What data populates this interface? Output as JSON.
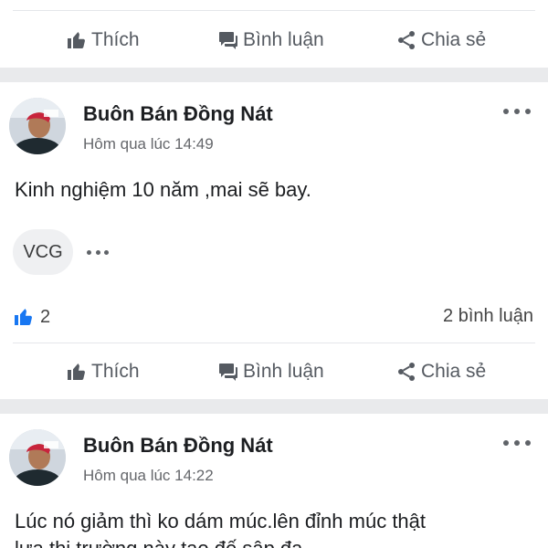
{
  "actions": {
    "like": "Thích",
    "comment": "Bình luận",
    "share": "Chia sẻ"
  },
  "posts": [
    {
      "author": "Buôn Bán Đồng Nát",
      "time": "Hôm qua lúc 14:49",
      "text": "Kinh nghiệm 10 năm ,mai sẽ bay.",
      "tag": "VCG",
      "likes": "2",
      "comments": "2 bình luận"
    },
    {
      "author": "Buôn Bán Đồng Nát",
      "time": "Hôm qua lúc 14:22",
      "text_line1": "Lúc nó giảm thì ko dám múc.lên đỉnh múc thật",
      "text_line2": "lựa thị trường này tạo đế sập đạ"
    }
  ],
  "colors": {
    "accent": "#1877f2",
    "icon_gray": "#555a61",
    "separator": "#e9eaec"
  },
  "icons": [
    "thumbs-up-icon",
    "comment-icon",
    "share-icon",
    "more-icon",
    "like-reaction-icon"
  ]
}
